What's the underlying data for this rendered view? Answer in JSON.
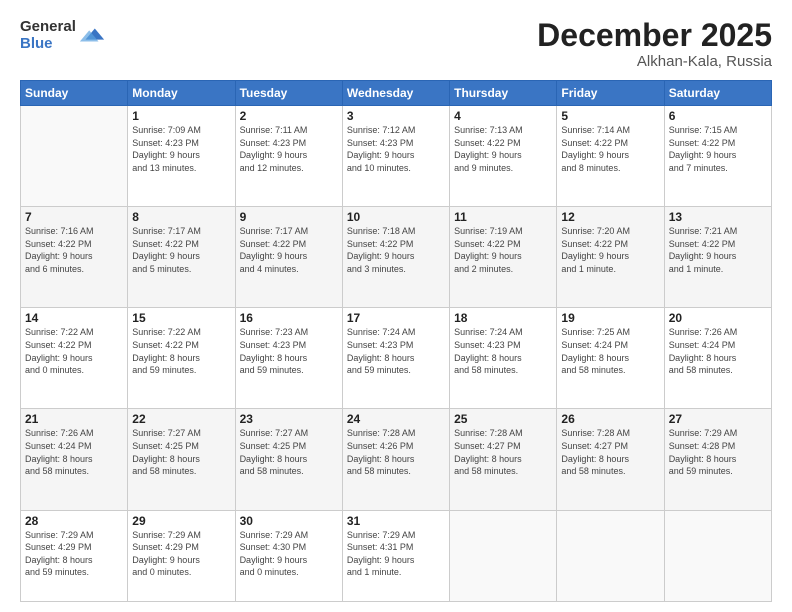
{
  "header": {
    "logo_general": "General",
    "logo_blue": "Blue",
    "month_year": "December 2025",
    "location": "Alkhan-Kala, Russia"
  },
  "days_of_week": [
    "Sunday",
    "Monday",
    "Tuesday",
    "Wednesday",
    "Thursday",
    "Friday",
    "Saturday"
  ],
  "weeks": [
    [
      {
        "day": "",
        "info": ""
      },
      {
        "day": "1",
        "info": "Sunrise: 7:09 AM\nSunset: 4:23 PM\nDaylight: 9 hours\nand 13 minutes."
      },
      {
        "day": "2",
        "info": "Sunrise: 7:11 AM\nSunset: 4:23 PM\nDaylight: 9 hours\nand 12 minutes."
      },
      {
        "day": "3",
        "info": "Sunrise: 7:12 AM\nSunset: 4:23 PM\nDaylight: 9 hours\nand 10 minutes."
      },
      {
        "day": "4",
        "info": "Sunrise: 7:13 AM\nSunset: 4:22 PM\nDaylight: 9 hours\nand 9 minutes."
      },
      {
        "day": "5",
        "info": "Sunrise: 7:14 AM\nSunset: 4:22 PM\nDaylight: 9 hours\nand 8 minutes."
      },
      {
        "day": "6",
        "info": "Sunrise: 7:15 AM\nSunset: 4:22 PM\nDaylight: 9 hours\nand 7 minutes."
      }
    ],
    [
      {
        "day": "7",
        "info": "Sunrise: 7:16 AM\nSunset: 4:22 PM\nDaylight: 9 hours\nand 6 minutes."
      },
      {
        "day": "8",
        "info": "Sunrise: 7:17 AM\nSunset: 4:22 PM\nDaylight: 9 hours\nand 5 minutes."
      },
      {
        "day": "9",
        "info": "Sunrise: 7:17 AM\nSunset: 4:22 PM\nDaylight: 9 hours\nand 4 minutes."
      },
      {
        "day": "10",
        "info": "Sunrise: 7:18 AM\nSunset: 4:22 PM\nDaylight: 9 hours\nand 3 minutes."
      },
      {
        "day": "11",
        "info": "Sunrise: 7:19 AM\nSunset: 4:22 PM\nDaylight: 9 hours\nand 2 minutes."
      },
      {
        "day": "12",
        "info": "Sunrise: 7:20 AM\nSunset: 4:22 PM\nDaylight: 9 hours\nand 1 minute."
      },
      {
        "day": "13",
        "info": "Sunrise: 7:21 AM\nSunset: 4:22 PM\nDaylight: 9 hours\nand 1 minute."
      }
    ],
    [
      {
        "day": "14",
        "info": "Sunrise: 7:22 AM\nSunset: 4:22 PM\nDaylight: 9 hours\nand 0 minutes."
      },
      {
        "day": "15",
        "info": "Sunrise: 7:22 AM\nSunset: 4:22 PM\nDaylight: 8 hours\nand 59 minutes."
      },
      {
        "day": "16",
        "info": "Sunrise: 7:23 AM\nSunset: 4:23 PM\nDaylight: 8 hours\nand 59 minutes."
      },
      {
        "day": "17",
        "info": "Sunrise: 7:24 AM\nSunset: 4:23 PM\nDaylight: 8 hours\nand 59 minutes."
      },
      {
        "day": "18",
        "info": "Sunrise: 7:24 AM\nSunset: 4:23 PM\nDaylight: 8 hours\nand 58 minutes."
      },
      {
        "day": "19",
        "info": "Sunrise: 7:25 AM\nSunset: 4:24 PM\nDaylight: 8 hours\nand 58 minutes."
      },
      {
        "day": "20",
        "info": "Sunrise: 7:26 AM\nSunset: 4:24 PM\nDaylight: 8 hours\nand 58 minutes."
      }
    ],
    [
      {
        "day": "21",
        "info": "Sunrise: 7:26 AM\nSunset: 4:24 PM\nDaylight: 8 hours\nand 58 minutes."
      },
      {
        "day": "22",
        "info": "Sunrise: 7:27 AM\nSunset: 4:25 PM\nDaylight: 8 hours\nand 58 minutes."
      },
      {
        "day": "23",
        "info": "Sunrise: 7:27 AM\nSunset: 4:25 PM\nDaylight: 8 hours\nand 58 minutes."
      },
      {
        "day": "24",
        "info": "Sunrise: 7:28 AM\nSunset: 4:26 PM\nDaylight: 8 hours\nand 58 minutes."
      },
      {
        "day": "25",
        "info": "Sunrise: 7:28 AM\nSunset: 4:27 PM\nDaylight: 8 hours\nand 58 minutes."
      },
      {
        "day": "26",
        "info": "Sunrise: 7:28 AM\nSunset: 4:27 PM\nDaylight: 8 hours\nand 58 minutes."
      },
      {
        "day": "27",
        "info": "Sunrise: 7:29 AM\nSunset: 4:28 PM\nDaylight: 8 hours\nand 59 minutes."
      }
    ],
    [
      {
        "day": "28",
        "info": "Sunrise: 7:29 AM\nSunset: 4:29 PM\nDaylight: 8 hours\nand 59 minutes."
      },
      {
        "day": "29",
        "info": "Sunrise: 7:29 AM\nSunset: 4:29 PM\nDaylight: 9 hours\nand 0 minutes."
      },
      {
        "day": "30",
        "info": "Sunrise: 7:29 AM\nSunset: 4:30 PM\nDaylight: 9 hours\nand 0 minutes."
      },
      {
        "day": "31",
        "info": "Sunrise: 7:29 AM\nSunset: 4:31 PM\nDaylight: 9 hours\nand 1 minute."
      },
      {
        "day": "",
        "info": ""
      },
      {
        "day": "",
        "info": ""
      },
      {
        "day": "",
        "info": ""
      }
    ]
  ]
}
